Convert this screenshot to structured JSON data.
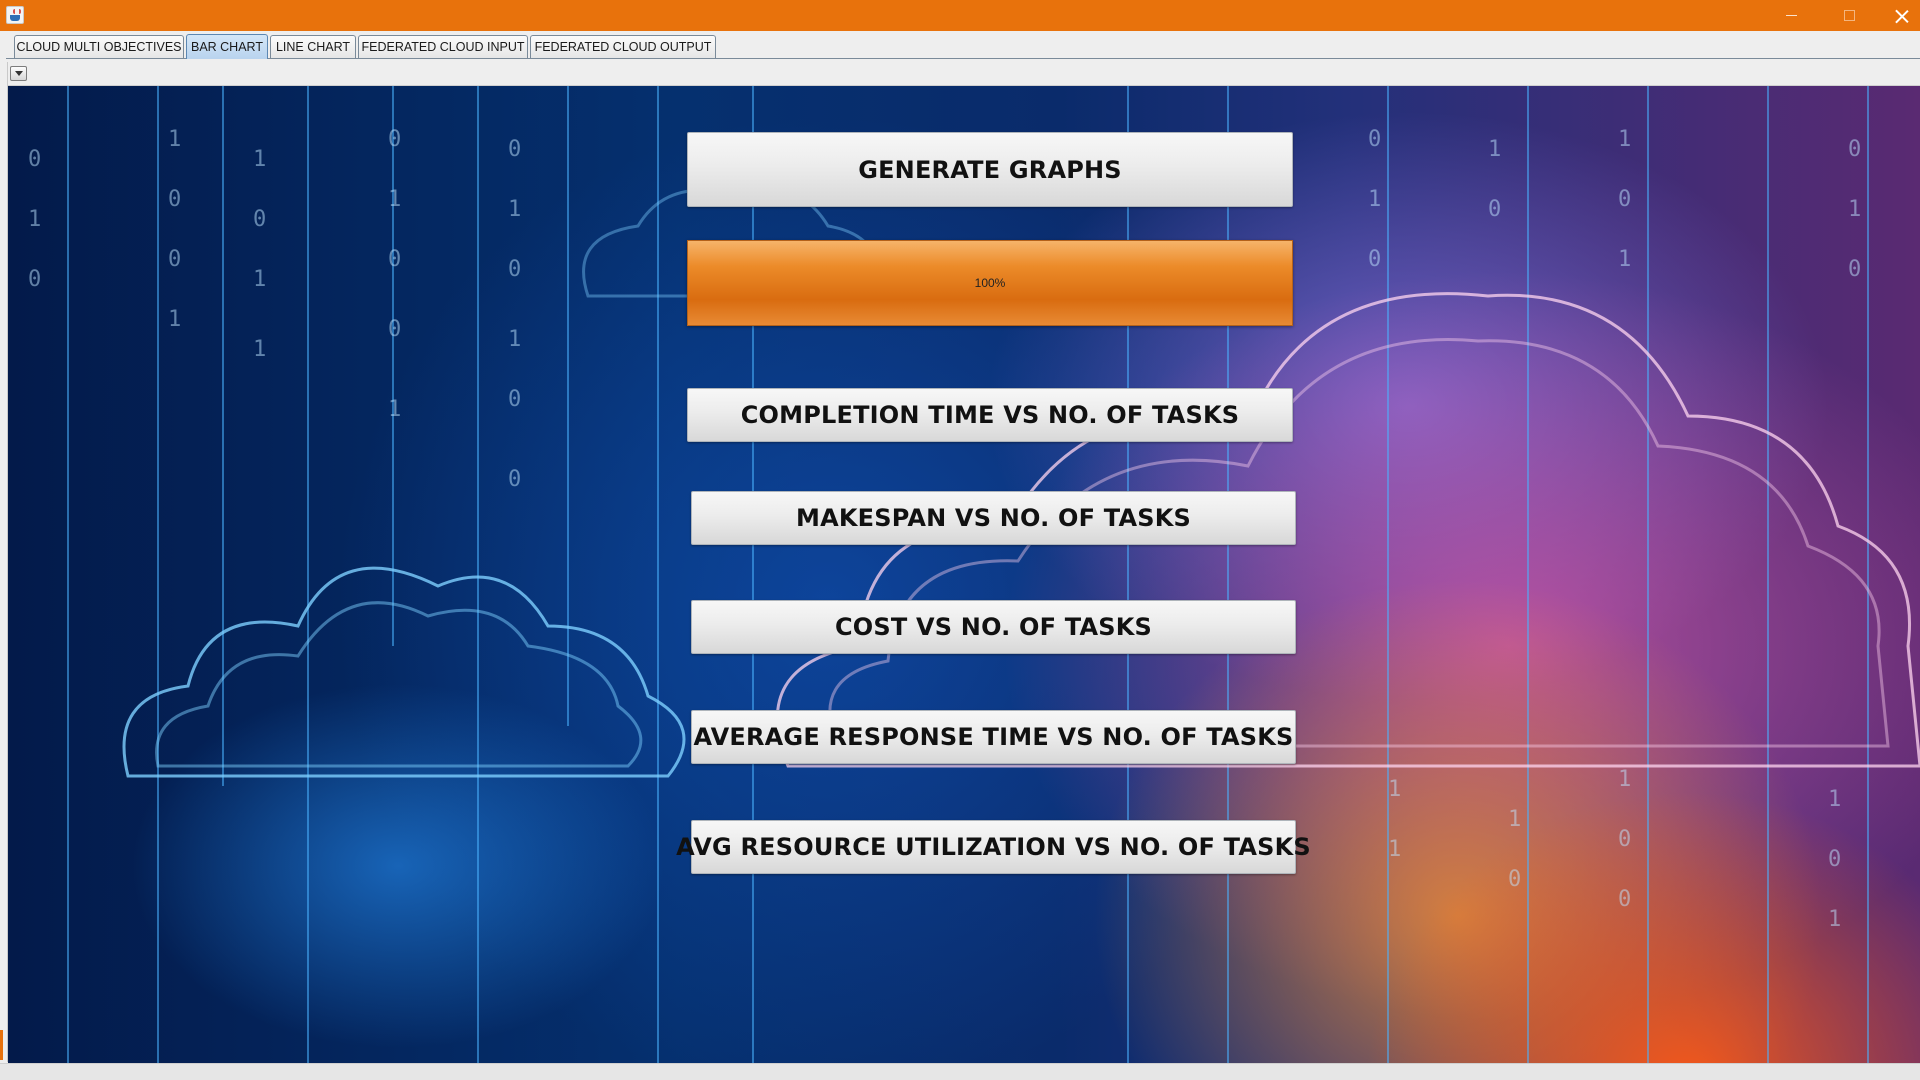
{
  "window": {
    "icon": "java-cup-icon",
    "controls": [
      "minimize-icon",
      "maximize-icon",
      "close-icon"
    ]
  },
  "tabs": [
    {
      "label": "CLOUD MULTI OBJECTIVES",
      "active": false
    },
    {
      "label": "BAR CHART",
      "active": true
    },
    {
      "label": "LINE CHART",
      "active": false
    },
    {
      "label": "FEDERATED CLOUD INPUT",
      "active": false
    },
    {
      "label": "FEDERATED CLOUD OUTPUT",
      "active": false
    }
  ],
  "toolbar": {
    "dropdown_icon": "chevron-down-icon"
  },
  "main": {
    "generate_label": "GENERATE GRAPHS",
    "progress": {
      "text": "100%",
      "value": 1.0,
      "color": "#e27a1c"
    },
    "buttons": [
      {
        "label": "COMPLETION TIME VS NO. OF TASKS"
      },
      {
        "label": "MAKESPAN VS NO. OF TASKS"
      },
      {
        "label": "COST VS NO. OF TASKS"
      },
      {
        "label": "AVERAGE RESPONSE TIME VS NO. OF TASKS"
      },
      {
        "label": "AVG RESOURCE UTILIZATION VS NO. OF TASKS"
      }
    ]
  },
  "colors": {
    "titlebar": "#e8720c",
    "active_tab": "#b8d3ee",
    "background_blue": "#05306f",
    "background_orange": "#ff5a14"
  }
}
